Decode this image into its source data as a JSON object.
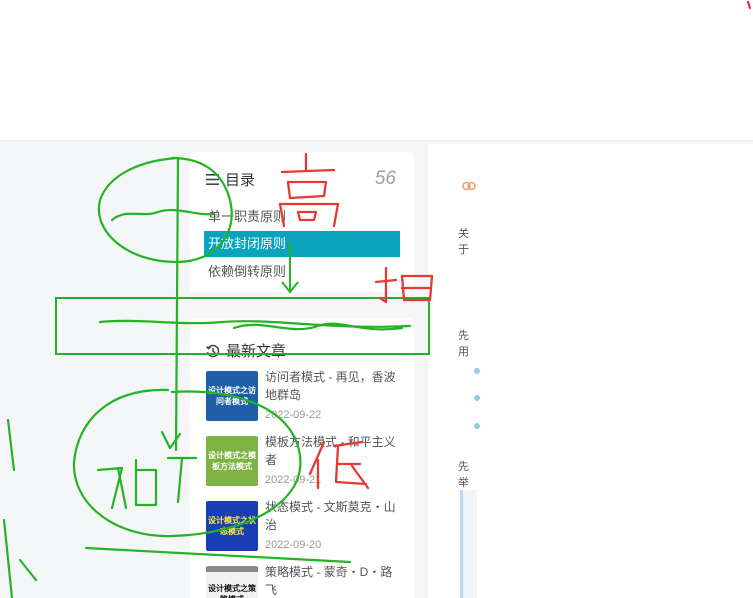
{
  "toc": {
    "title": "目录",
    "count": "56",
    "items": [
      {
        "label": "单一职责原则",
        "active": false
      },
      {
        "label": "开放封闭原则",
        "active": true
      },
      {
        "label": "依赖倒转原则",
        "active": false
      }
    ]
  },
  "recent": {
    "title": "最新文章",
    "posts": [
      {
        "title": "访问者模式 - 再见，香波地群岛",
        "date": "2022-09-22",
        "thumb_text": "设计模式之访问者模式",
        "thumb_color": "#1e5fa8"
      },
      {
        "title": "模板方法模式 - 和平主义者",
        "date": "2022-09-21",
        "thumb_text": "设计模式之模板方法模式",
        "thumb_color": "#7cb342"
      },
      {
        "title": "状态模式 - 文斯莫克・山治",
        "date": "2022-09-20",
        "thumb_text": "设计模式之状态模式",
        "thumb_color": "#1a3fb5"
      },
      {
        "title": "策略模式 - 蒙奇・D・路飞",
        "date": "",
        "thumb_text": "设计模式之策略模式",
        "thumb_color": "#f2f2f2"
      }
    ]
  },
  "right_column": {
    "labels": [
      "关于",
      "先用",
      "先举"
    ]
  },
  "annotations": {
    "handwritten": [
      "高",
      "扣",
      "加",
      "低"
    ],
    "ink_colors": {
      "red": "#e53935",
      "green": "#22b422"
    }
  },
  "colors": {
    "accent": "#0aa3be",
    "muted": "#9aa0a6"
  }
}
